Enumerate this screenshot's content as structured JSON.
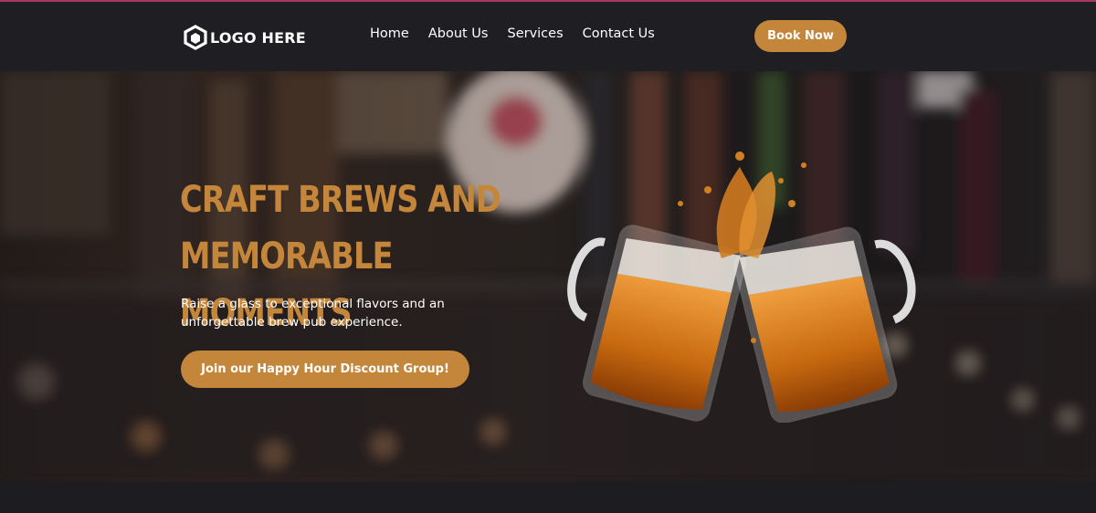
{
  "header": {
    "logo_text": "LOGO HERE",
    "nav": [
      "Home",
      "About Us",
      "Services",
      "Contact Us"
    ],
    "book_label": "Book Now"
  },
  "hero": {
    "title_line1": "Craft Brews and",
    "title_line2": "Memorable Moments",
    "subtitle": "Raise a glass to exceptional flavors and an unforgettable brew pub experience.",
    "cta_label": "Join our Happy Hour Discount Group!"
  },
  "colors": {
    "accent": "#c4863a",
    "header_bg": "#1f1e23",
    "page_bg": "#1d1c21"
  }
}
